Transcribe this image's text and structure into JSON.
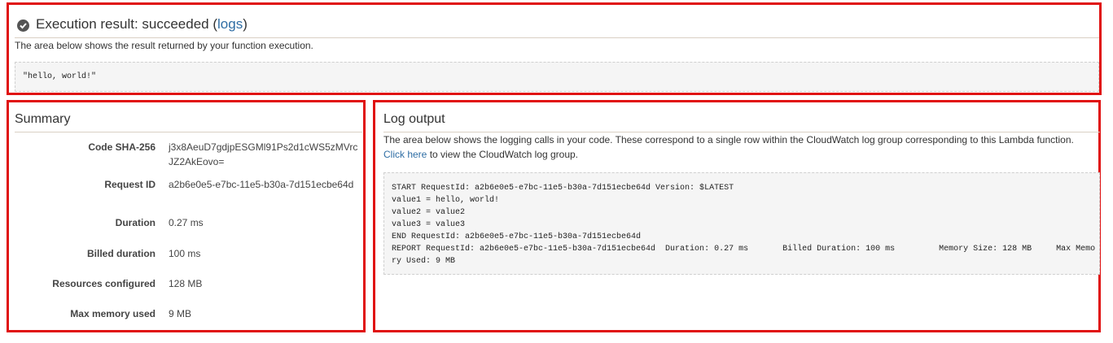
{
  "execution": {
    "title_prefix": "Execution result: succeeded (",
    "logs_link": "logs",
    "title_suffix": ")",
    "description": "The area below shows the result returned by your function execution.",
    "result": "\"hello, world!\""
  },
  "summary": {
    "title": "Summary",
    "rows": [
      {
        "label": "Code SHA-256",
        "value": "j3x8AeuD7gdjpESGMl91Ps2d1cWS5zMVrcJZ2AkEovo="
      },
      {
        "label": "Request ID",
        "value": "a2b6e0e5-e7bc-11e5-b30a-7d151ecbe64d"
      },
      {
        "label": "Duration",
        "value": "0.27 ms"
      },
      {
        "label": "Billed duration",
        "value": "100 ms"
      },
      {
        "label": "Resources configured",
        "value": "128 MB"
      },
      {
        "label": "Max memory used",
        "value": "9 MB"
      }
    ]
  },
  "log": {
    "title": "Log output",
    "description_part1": "The area below shows the logging calls in your code. These correspond to a single row within the CloudWatch log group corresponding to this Lambda function. ",
    "click_here": "Click here",
    "description_part2": " to view the CloudWatch log group.",
    "lines": [
      "START RequestId: a2b6e0e5-e7bc-11e5-b30a-7d151ecbe64d Version: $LATEST",
      "value1 = hello, world!",
      "value2 = value2",
      "value3 = value3",
      "END RequestId: a2b6e0e5-e7bc-11e5-b30a-7d151ecbe64d",
      "REPORT RequestId: a2b6e0e5-e7bc-11e5-b30a-7d151ecbe64d  Duration: 0.27 ms       Billed Duration: 100 ms         Memory Size: 128 MB     Max Memo",
      "ry Used: 9 MB"
    ]
  },
  "colors": {
    "highlight_border": "#e01010",
    "link": "#2e6da4",
    "code_bg": "#f5f5f5"
  }
}
